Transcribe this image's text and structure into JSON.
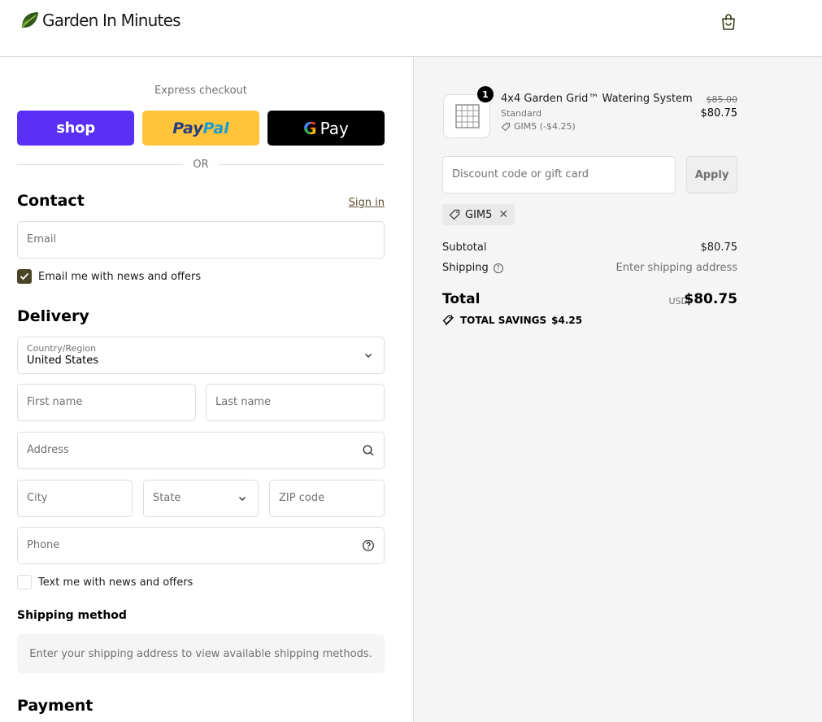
{
  "header": {
    "brand": "Garden In Minutes"
  },
  "express": {
    "label": "Express checkout",
    "shop_label": "shop",
    "paypal_part1": "Pay",
    "paypal_part2": "Pal",
    "gpay_g": "G",
    "gpay_label": "Pay",
    "or_label": "OR"
  },
  "contact": {
    "title": "Contact",
    "sign_in": "Sign in",
    "email_placeholder": "Email",
    "email_opt_in": "Email me with news and offers",
    "email_opt_in_checked": true
  },
  "delivery": {
    "title": "Delivery",
    "country_label": "Country/Region",
    "country_value": "United States",
    "first_name_placeholder": "First name",
    "last_name_placeholder": "Last name",
    "address_placeholder": "Address",
    "city_placeholder": "City",
    "state_placeholder": "State",
    "zip_placeholder": "ZIP code",
    "phone_placeholder": "Phone",
    "sms_opt_in": "Text me with news and offers",
    "sms_opt_in_checked": false
  },
  "shipping_method": {
    "title": "Shipping method",
    "message": "Enter your shipping address to view available shipping methods."
  },
  "payment": {
    "title": "Payment"
  },
  "summary": {
    "product": {
      "quantity": "1",
      "name": "4x4 Garden Grid™ Watering System",
      "variant": "Standard",
      "discount": "GIM5 (-$4.25)",
      "original_price": "$85.00",
      "price": "$80.75"
    },
    "discount_placeholder": "Discount code or gift card",
    "apply_label": "Apply",
    "applied_code": "GIM5",
    "subtotal_label": "Subtotal",
    "subtotal_value": "$80.75",
    "shipping_label": "Shipping",
    "shipping_value": "Enter shipping address",
    "total_label": "Total",
    "total_currency": "USD",
    "total_value": "$80.75",
    "savings_label": "TOTAL SAVINGS",
    "savings_value": "$4.25"
  },
  "colors": {
    "shop_purple": "#5a31f4",
    "paypal_yellow": "#ffc439",
    "checkbox_olive": "#4a4526"
  }
}
